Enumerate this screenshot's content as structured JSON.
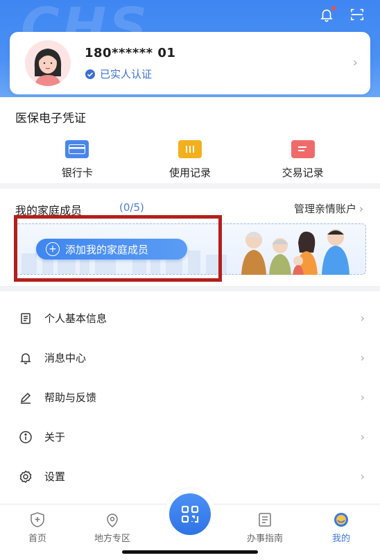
{
  "hero": {
    "bg_text": "CHS"
  },
  "profile": {
    "phone": "180****** 01",
    "verified_text": "已实人认证"
  },
  "certificate": {
    "title": "医保电子凭证",
    "quick_items": [
      {
        "label": "银行卡",
        "icon": "bank-card-icon",
        "color": "#4a86ea"
      },
      {
        "label": "使用记录",
        "icon": "usage-record-icon",
        "color": "#f2b01e"
      },
      {
        "label": "交易记录",
        "icon": "transaction-record-icon",
        "color": "#ef6b6b"
      }
    ]
  },
  "family": {
    "title": "我的家庭成员",
    "count": "(0/5)",
    "manage_link": "管理亲情账户",
    "add_button": "添加我的家庭成员"
  },
  "menu": [
    {
      "label": "个人基本信息",
      "icon": "document-icon"
    },
    {
      "label": "消息中心",
      "icon": "bell-icon"
    },
    {
      "label": "帮助与反馈",
      "icon": "pencil-icon"
    },
    {
      "label": "关于",
      "icon": "info-icon"
    },
    {
      "label": "设置",
      "icon": "settings-icon"
    }
  ],
  "tabs": [
    {
      "label": "首页",
      "icon": "home-shield-icon"
    },
    {
      "label": "地方专区",
      "icon": "location-icon"
    },
    {
      "label": "办事指南",
      "icon": "guide-icon"
    },
    {
      "label": "我的",
      "icon": "profile-icon",
      "active": true
    }
  ],
  "colors": {
    "accent": "#3b78e0",
    "highlight_box": "#b3201c"
  }
}
